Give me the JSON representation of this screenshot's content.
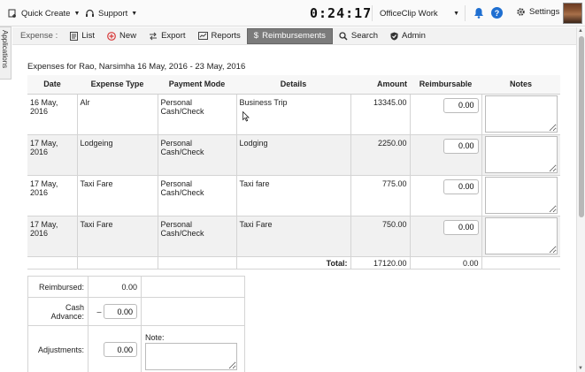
{
  "topbar": {
    "quick_create": "Quick Create",
    "support": "Support",
    "clock": "0:24:17",
    "company": "OfficeClip Work",
    "settings": "Settings"
  },
  "sidetab": {
    "label": "Applications"
  },
  "toolbar": {
    "section_label": "Expense :",
    "list": "List",
    "new": "New",
    "export": "Export",
    "reports": "Reports",
    "reimbursements": "Reimbursements",
    "search": "Search",
    "admin": "Admin"
  },
  "page": {
    "title": "Expenses for Rao, Narsimha 16 May, 2016 - 23 May, 2016"
  },
  "table": {
    "headers": [
      "Date",
      "Expense Type",
      "Payment Mode",
      "Details",
      "Amount",
      "Reimbursable",
      "Notes"
    ],
    "rows": [
      {
        "date": "16 May, 2016",
        "type": "Alr",
        "mode": "Personal Cash/Check",
        "details": "Business Trip",
        "amount": "13345.00",
        "reimbursable": "0.00"
      },
      {
        "date": "17 May, 2016",
        "type": "Lodgeing",
        "mode": "Personal Cash/Check",
        "details": "Lodging",
        "amount": "2250.00",
        "reimbursable": "0.00"
      },
      {
        "date": "17 May, 2016",
        "type": "Taxi Fare",
        "mode": "Personal Cash/Check",
        "details": "Taxi fare",
        "amount": "775.00",
        "reimbursable": "0.00"
      },
      {
        "date": "17 May, 2016",
        "type": "Taxi Fare",
        "mode": "Personal Cash/Check",
        "details": "Taxi Fare",
        "amount": "750.00",
        "reimbursable": "0.00"
      }
    ],
    "total_label": "Total:",
    "total_amount": "17120.00",
    "total_reimbursable": "0.00"
  },
  "summary": {
    "reimbursed_label": "Reimbursed:",
    "reimbursed_value": "0.00",
    "cash_advance_label": "Cash Advance:",
    "cash_advance_sign": "–",
    "cash_advance_value": "0.00",
    "adjustments_label": "Adjustments:",
    "adjustments_value": "0.00",
    "note_label": "Note:"
  },
  "colors": {
    "active_tab": "#7b7b7b",
    "help_blue": "#1f6fd1",
    "alt_row": "#f1f1f1"
  }
}
